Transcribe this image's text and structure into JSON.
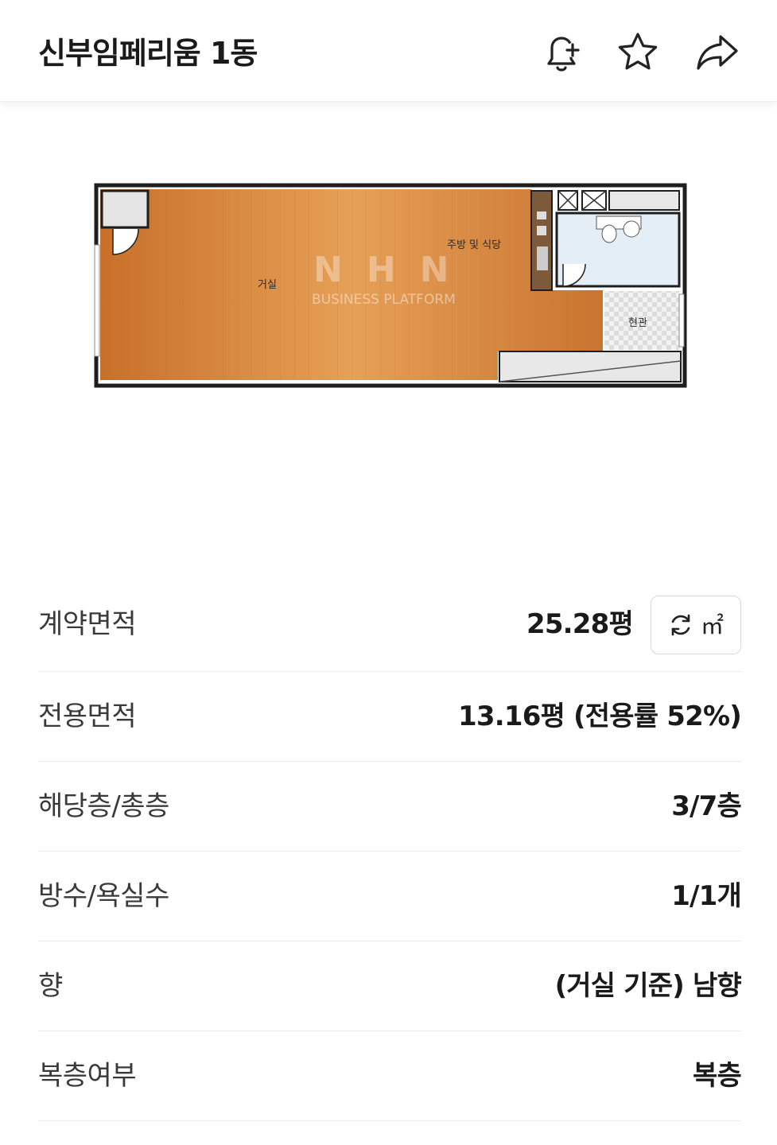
{
  "header": {
    "title": "신부임페리움 1동",
    "icons": [
      "bell-plus-icon",
      "star-icon",
      "share-icon"
    ]
  },
  "floorplan": {
    "rooms": {
      "living": "거실",
      "kitchen": "주방 및 식당",
      "entrance": "현관"
    },
    "watermark": {
      "logo": "NHN",
      "text": "BUSINESS PLATFORM"
    }
  },
  "details": {
    "contract_area": {
      "label": "계약면적",
      "value": "25.28평",
      "unit_toggle": "㎡"
    },
    "exclusive_area": {
      "label": "전용면적",
      "value": "13.16평 (전용률 52%)"
    },
    "floor": {
      "label": "해당층/총층",
      "value": "3/7층"
    },
    "rooms": {
      "label": "방수/욕실수",
      "value": "1/1개"
    },
    "direction": {
      "label": "향",
      "value": "(거실 기준) 남향"
    },
    "duplex": {
      "label": "복층여부",
      "value": "복층"
    }
  },
  "colors": {
    "floor_wood": "#d9873a",
    "bath": "#e3eef6",
    "wall": "#1e1e1e",
    "divider": "#ebebeb"
  }
}
